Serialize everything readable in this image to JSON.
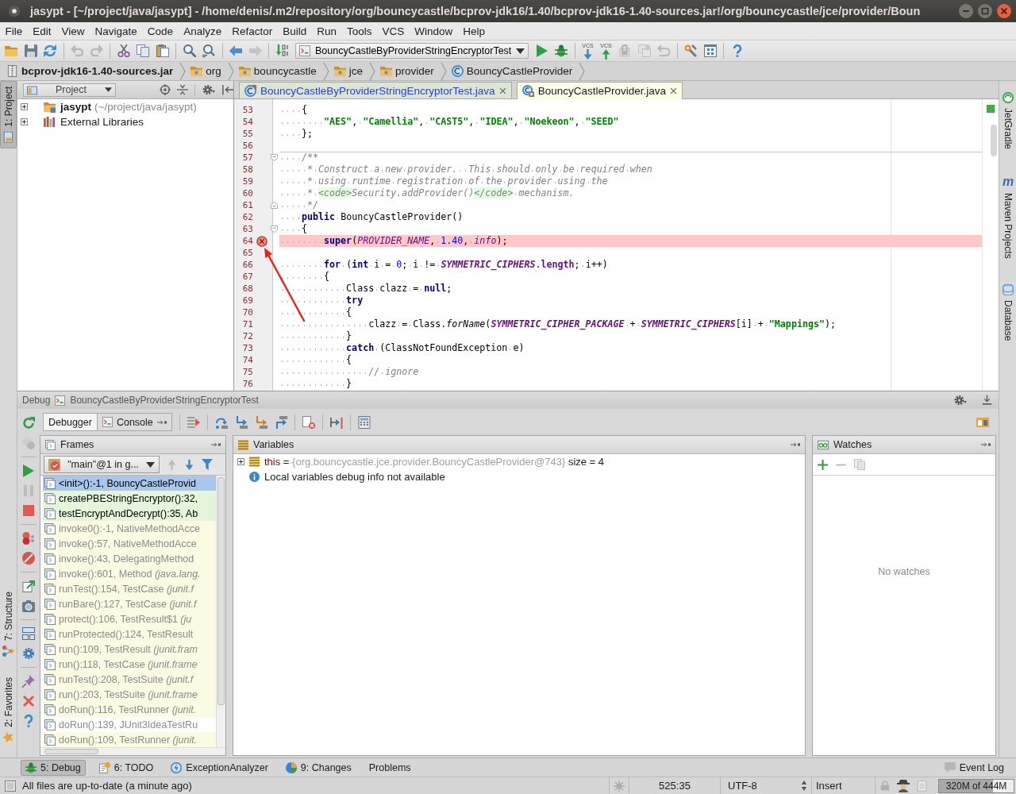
{
  "window": {
    "title": "jasypt - [~/project/java/jasypt] - /home/denis/.m2/repository/org/bouncycastle/bcprov-jdk16/1.40/bcprov-jdk16-1.40-sources.jar!/org/bouncycastle/jce/provider/Boun"
  },
  "menu": [
    "File",
    "Edit",
    "View",
    "Navigate",
    "Code",
    "Analyze",
    "Refactor",
    "Build",
    "Run",
    "Tools",
    "VCS",
    "Window",
    "Help"
  ],
  "toolbar": {
    "run_configuration": "BouncyCastleByProviderStringEncryptorTest",
    "vcs_buttons": [
      {
        "label": "VCS",
        "kind": "update"
      },
      {
        "label": "VCS",
        "kind": "commit"
      }
    ]
  },
  "breadcrumbs": [
    {
      "label": "bcprov-jdk16-1.40-sources.jar",
      "kind": "archive"
    },
    {
      "label": "org",
      "kind": "package"
    },
    {
      "label": "bouncycastle",
      "kind": "package"
    },
    {
      "label": "jce",
      "kind": "package"
    },
    {
      "label": "provider",
      "kind": "package"
    },
    {
      "label": "BouncyCastleProvider",
      "kind": "class"
    }
  ],
  "left_tool_windows": {
    "top": [
      {
        "label": "1: Project",
        "kind": "project",
        "selected": true
      }
    ],
    "bottom": [
      {
        "label": "7: Structure",
        "kind": "structure",
        "selected": false
      },
      {
        "label": "2: Favorites",
        "kind": "favorites",
        "selected": false
      }
    ]
  },
  "right_tool_windows": [
    {
      "label": "JetGradle",
      "kind": "gradle"
    },
    {
      "label": "Maven Projects",
      "kind": "maven",
      "icon_text": "m"
    },
    {
      "label": "Database",
      "kind": "database"
    }
  ],
  "project_panel": {
    "title": "Project",
    "tree": [
      {
        "label": "jasypt",
        "detail": "(~/project/java/jasypt)",
        "kind": "module",
        "expanded": false
      },
      {
        "label": "External Libraries",
        "kind": "libraries",
        "expanded": false
      }
    ]
  },
  "editor": {
    "tabs": [
      {
        "label": "BouncyCastleByProviderStringEncryptorTest.java",
        "kind": "test_class",
        "modified": true,
        "selected": false
      },
      {
        "label": "BouncyCastleProvider.java",
        "kind": "library_class",
        "modified": false,
        "selected": true
      }
    ],
    "lines": [
      {
        "number": "53",
        "breakpoint": false,
        "fold_start": false,
        "fold_end": false,
        "separator": false,
        "tokens": [
          {
            "kind": "plain",
            "text": "    {"
          }
        ]
      },
      {
        "number": "54",
        "breakpoint": false,
        "fold_start": false,
        "fold_end": false,
        "separator": false,
        "tokens": [
          {
            "kind": "string",
            "text": "        \"AES\""
          },
          {
            "kind": "plain",
            "text": ", "
          },
          {
            "kind": "string",
            "text": "\"Camellia\""
          },
          {
            "kind": "plain",
            "text": ", "
          },
          {
            "kind": "string",
            "text": "\"CAST5\""
          },
          {
            "kind": "plain",
            "text": ", "
          },
          {
            "kind": "string",
            "text": "\"IDEA\""
          },
          {
            "kind": "plain",
            "text": ", "
          },
          {
            "kind": "string",
            "text": "\"Noekeon\""
          },
          {
            "kind": "plain",
            "text": ", "
          },
          {
            "kind": "string",
            "text": "\"SEED\""
          }
        ]
      },
      {
        "number": "55",
        "breakpoint": false,
        "fold_start": false,
        "fold_end": false,
        "separator": false,
        "tokens": [
          {
            "kind": "plain",
            "text": "    };"
          }
        ]
      },
      {
        "number": "56",
        "breakpoint": false,
        "fold_start": false,
        "fold_end": false,
        "separator": false
      },
      {
        "number": "57",
        "breakpoint": false,
        "fold_start": true,
        "fold_end": false,
        "separator": true,
        "tokens": [
          {
            "kind": "doc",
            "text": "    /**"
          }
        ]
      },
      {
        "number": "58",
        "breakpoint": false,
        "fold_start": false,
        "fold_end": false,
        "separator": false,
        "tokens": [
          {
            "kind": "doc",
            "text": "     * Construct a new provider.  This should only be required when"
          }
        ]
      },
      {
        "number": "59",
        "breakpoint": false,
        "fold_start": false,
        "fold_end": false,
        "separator": false,
        "tokens": [
          {
            "kind": "doc",
            "text": "     * using runtime registration of the provider using the"
          }
        ]
      },
      {
        "number": "60",
        "breakpoint": false,
        "fold_start": false,
        "fold_end": false,
        "separator": false,
        "tokens": [
          {
            "kind": "doc",
            "text": "     * "
          },
          {
            "kind": "doc_tag",
            "text": "<code>"
          },
          {
            "kind": "doc",
            "text": "Security.addProvider()"
          },
          {
            "kind": "doc_tag",
            "text": "</code>"
          },
          {
            "kind": "doc",
            "text": " mechanism."
          }
        ]
      },
      {
        "number": "61",
        "breakpoint": false,
        "fold_start": false,
        "fold_end": true,
        "separator": false,
        "tokens": [
          {
            "kind": "doc",
            "text": "     */"
          }
        ]
      },
      {
        "number": "62",
        "breakpoint": false,
        "fold_start": false,
        "fold_end": false,
        "separator": false,
        "tokens": [
          {
            "kind": "keyword",
            "text": "    public"
          },
          {
            "kind": "plain",
            "text": " BouncyCastleProvider()"
          }
        ]
      },
      {
        "number": "63",
        "breakpoint": false,
        "fold_start": true,
        "fold_end": false,
        "separator": false,
        "tokens": [
          {
            "kind": "plain",
            "text": "    {"
          }
        ]
      },
      {
        "number": "64",
        "breakpoint": true,
        "fold_start": false,
        "fold_end": false,
        "separator": false,
        "tokens": [
          {
            "kind": "keyword",
            "text": "        super"
          },
          {
            "kind": "plain",
            "text": "("
          },
          {
            "kind": "field",
            "text": "PROVIDER_NAME"
          },
          {
            "kind": "plain",
            "text": ", "
          },
          {
            "kind": "number",
            "text": "1.40"
          },
          {
            "kind": "plain",
            "text": ", "
          },
          {
            "kind": "field",
            "text": "info"
          },
          {
            "kind": "plain",
            "text": ");"
          }
        ]
      },
      {
        "number": "65",
        "breakpoint": false,
        "fold_start": false,
        "fold_end": false,
        "separator": false
      },
      {
        "number": "66",
        "breakpoint": false,
        "fold_start": false,
        "fold_end": false,
        "separator": false,
        "tokens": [
          {
            "kind": "keyword",
            "text": "        for"
          },
          {
            "kind": "plain",
            "text": " ("
          },
          {
            "kind": "keyword",
            "text": "int"
          },
          {
            "kind": "plain",
            "text": " i = "
          },
          {
            "kind": "number",
            "text": "0"
          },
          {
            "kind": "plain",
            "text": "; i != "
          },
          {
            "kind": "constant",
            "text": "SYMMETRIC_CIPHERS"
          },
          {
            "kind": "plain",
            "text": "."
          },
          {
            "kind": "member",
            "text": "length"
          },
          {
            "kind": "plain",
            "text": "; i++)"
          }
        ]
      },
      {
        "number": "67",
        "breakpoint": false,
        "fold_start": false,
        "fold_end": false,
        "separator": false,
        "tokens": [
          {
            "kind": "plain",
            "text": "        {"
          }
        ]
      },
      {
        "number": "68",
        "breakpoint": false,
        "fold_start": false,
        "fold_end": false,
        "separator": false,
        "tokens": [
          {
            "kind": "plain",
            "text": "            Class clazz = "
          },
          {
            "kind": "keyword",
            "text": "null"
          },
          {
            "kind": "plain",
            "text": ";"
          }
        ]
      },
      {
        "number": "69",
        "breakpoint": false,
        "fold_start": false,
        "fold_end": false,
        "separator": false,
        "tokens": [
          {
            "kind": "keyword",
            "text": "            try"
          }
        ]
      },
      {
        "number": "70",
        "breakpoint": false,
        "fold_start": false,
        "fold_end": false,
        "separator": false,
        "tokens": [
          {
            "kind": "plain",
            "text": "            {"
          }
        ]
      },
      {
        "number": "71",
        "breakpoint": false,
        "fold_start": false,
        "fold_end": false,
        "separator": false,
        "tokens": [
          {
            "kind": "plain",
            "text": "                clazz = Class."
          },
          {
            "kind": "static_call",
            "text": "forName"
          },
          {
            "kind": "plain",
            "text": "("
          },
          {
            "kind": "constant",
            "text": "SYMMETRIC_CIPHER_PACKAGE"
          },
          {
            "kind": "plain",
            "text": " + "
          },
          {
            "kind": "constant",
            "text": "SYMMETRIC_CIPHERS"
          },
          {
            "kind": "plain",
            "text": "[i] + "
          },
          {
            "kind": "string",
            "text": "\"Mappings\""
          },
          {
            "kind": "plain",
            "text": ");"
          }
        ]
      },
      {
        "number": "72",
        "breakpoint": false,
        "fold_start": false,
        "fold_end": false,
        "separator": false,
        "tokens": [
          {
            "kind": "plain",
            "text": "            }"
          }
        ]
      },
      {
        "number": "73",
        "breakpoint": false,
        "fold_start": false,
        "fold_end": false,
        "separator": false,
        "tokens": [
          {
            "kind": "keyword",
            "text": "            catch"
          },
          {
            "kind": "plain",
            "text": " (ClassNotFoundException e)"
          }
        ]
      },
      {
        "number": "74",
        "breakpoint": false,
        "fold_start": false,
        "fold_end": false,
        "separator": false,
        "tokens": [
          {
            "kind": "plain",
            "text": "            {"
          }
        ]
      },
      {
        "number": "75",
        "breakpoint": false,
        "fold_start": false,
        "fold_end": false,
        "separator": false,
        "tokens": [
          {
            "kind": "comment",
            "text": "                // ignore"
          }
        ]
      },
      {
        "number": "76",
        "breakpoint": false,
        "fold_start": false,
        "fold_end": false,
        "separator": false,
        "tokens": [
          {
            "kind": "plain",
            "text": "            }"
          }
        ]
      }
    ]
  },
  "debug": {
    "title": "Debug",
    "session": "BouncyCastleByProviderStringEncryptorTest",
    "tabs": [
      {
        "label": "Debugger",
        "selected": true
      },
      {
        "label": "Console",
        "selected": false
      }
    ],
    "frames": {
      "title": "Frames",
      "thread": "\"main\"@1 in g...",
      "items": [
        {
          "text": "<init>():-1, BouncyCastleProvid",
          "kind": "library",
          "selected": true
        },
        {
          "text": "createPBEStringEncryptor():32,",
          "kind": "project",
          "selected": false
        },
        {
          "text": "testEncryptAndDecrypt():35, Ab",
          "kind": "project",
          "selected": false
        },
        {
          "text": "invoke0():-1, NativeMethodAcce",
          "kind": "library",
          "selected": false
        },
        {
          "text": "invoke():57, NativeMethodAcce",
          "kind": "library",
          "selected": false
        },
        {
          "text": "invoke():43, DelegatingMethod",
          "kind": "library",
          "selected": false
        },
        {
          "text": "invoke():601, Method *(java.lang.*",
          "kind": "library",
          "selected": false
        },
        {
          "text": "runTest():154, TestCase *(junit.f*",
          "kind": "library",
          "selected": false
        },
        {
          "text": "runBare():127, TestCase *(junit.f*",
          "kind": "library",
          "selected": false
        },
        {
          "text": "protect():106, TestResult$1 *(ju*",
          "kind": "library",
          "selected": false
        },
        {
          "text": "runProtected():124, TestResult",
          "kind": "library",
          "selected": false
        },
        {
          "text": "run():109, TestResult *(junit.fram*",
          "kind": "library",
          "selected": false
        },
        {
          "text": "run():118, TestCase *(junit.frame*",
          "kind": "library",
          "selected": false
        },
        {
          "text": "runTest():208, TestSuite *(junit.f*",
          "kind": "library",
          "selected": false
        },
        {
          "text": "run():203, TestSuite *(junit.frame*",
          "kind": "library",
          "selected": false
        },
        {
          "text": "doRun():116, TestRunner *(junit.*",
          "kind": "library",
          "selected": false
        },
        {
          "text": "doRun():139, JUnit3IdeaTestRu",
          "kind": "other",
          "selected": false
        },
        {
          "text": "doRun():109, TestRunner *(junit.*",
          "kind": "library",
          "selected": false
        }
      ]
    },
    "variables": {
      "title": "Variables",
      "items": [
        {
          "expanded": false,
          "tokens": [
            {
              "kind": "name",
              "text": "this"
            },
            {
              "kind": "plain",
              "text": " = "
            },
            {
              "kind": "value",
              "text": "{org.bouncycastle.jce.provider.BouncyCastleProvider@743}"
            },
            {
              "kind": "plain",
              "text": " size = 4"
            }
          ]
        }
      ],
      "message": "Local variables debug info not available"
    },
    "watches": {
      "title": "Watches",
      "empty_text": "No watches"
    }
  },
  "bottom_tool_windows": [
    {
      "label": "5: Debug",
      "kind": "debug",
      "selected": true
    },
    {
      "label": "6: TODO",
      "kind": "todo",
      "selected": false
    },
    {
      "label": "ExceptionAnalyzer",
      "kind": "exception",
      "selected": false
    },
    {
      "label": "9: Changes",
      "kind": "changes",
      "selected": false
    },
    {
      "label": "Problems",
      "kind": "problems",
      "selected": false
    }
  ],
  "event_log": "Event Log",
  "status_bar": {
    "message": "All files are up-to-date (a minute ago)",
    "caret_position": "525:35",
    "encoding": "UTF-8",
    "insert_mode": "Insert",
    "memory": {
      "text": "320M of 444M",
      "level": 0.72
    }
  }
}
